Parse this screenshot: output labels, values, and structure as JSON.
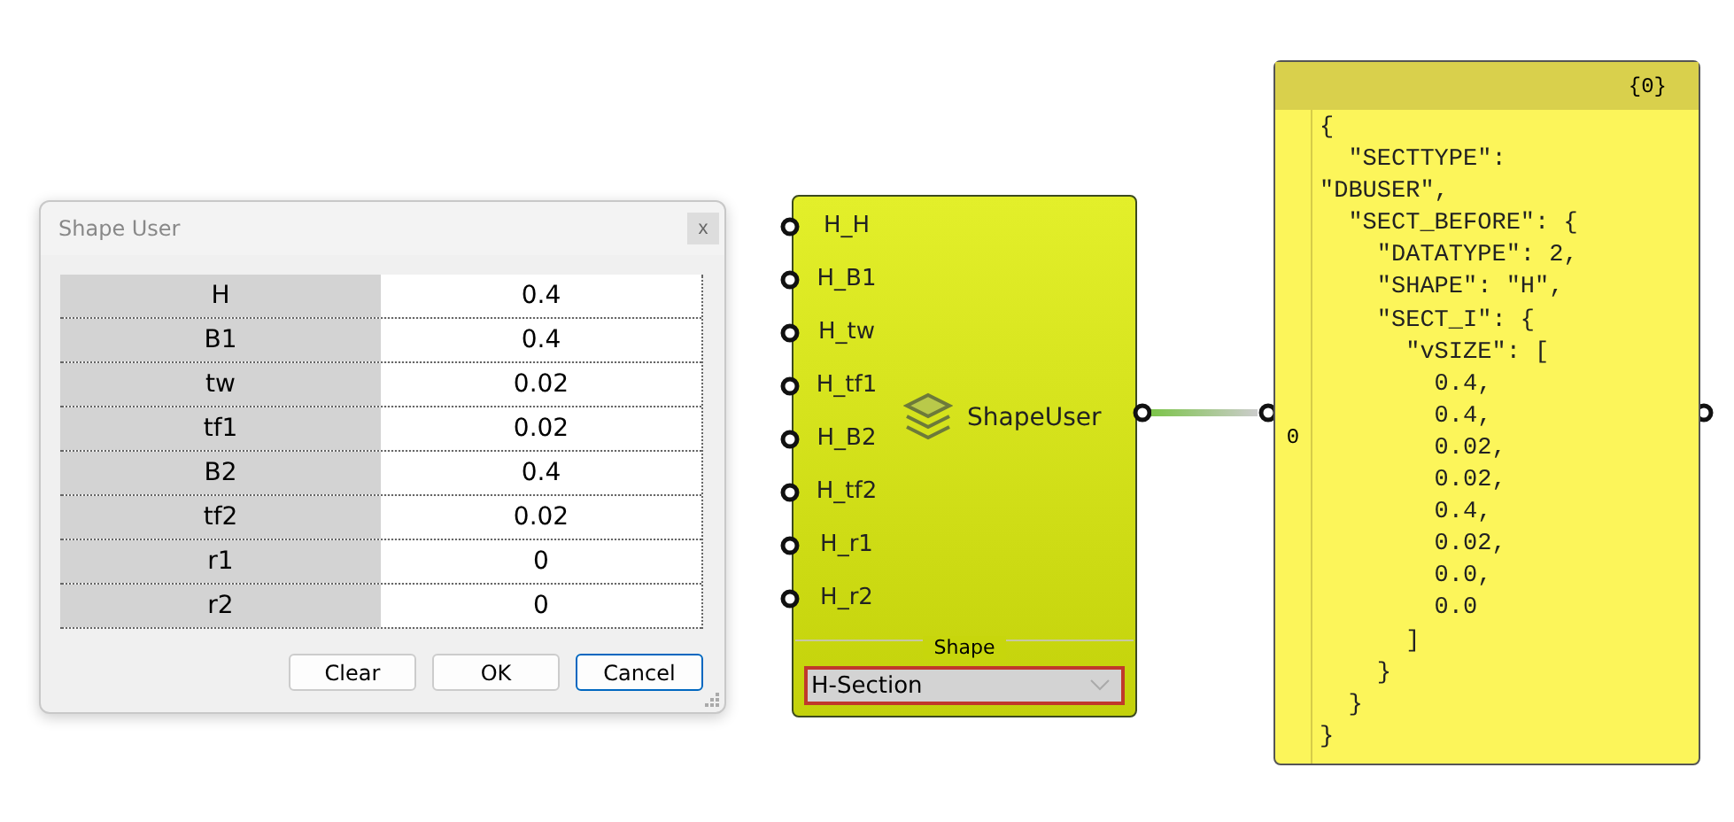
{
  "dialog": {
    "title": "Shape User",
    "close": "x",
    "rows": [
      {
        "label": "H",
        "value": "0.4"
      },
      {
        "label": "B1",
        "value": "0.4"
      },
      {
        "label": "tw",
        "value": "0.02"
      },
      {
        "label": "tf1",
        "value": "0.02"
      },
      {
        "label": "B2",
        "value": "0.4"
      },
      {
        "label": "tf2",
        "value": "0.02"
      },
      {
        "label": "r1",
        "value": "0"
      },
      {
        "label": "r2",
        "value": "0"
      }
    ],
    "buttons": [
      {
        "label": "Clear",
        "selected": false
      },
      {
        "label": "OK",
        "selected": false
      },
      {
        "label": "Cancel",
        "selected": true
      }
    ]
  },
  "component": {
    "name": "ShapeUser",
    "inputs": [
      "H_H",
      "H_B1",
      "H_tw",
      "H_tf1",
      "H_B2",
      "H_tf2",
      "H_r1",
      "H_r2"
    ],
    "section_label": "Shape",
    "dropdown": "H-Section"
  },
  "panel": {
    "header": "{0}",
    "index": "0",
    "lines": [
      "{",
      "  \"SECTTYPE\":",
      "\"DBUSER\",",
      "  \"SECT_BEFORE\": {",
      "    \"DATATYPE\": 2,",
      "    \"SHAPE\": \"H\",",
      "    \"SECT_I\": {",
      "      \"vSIZE\": [",
      "        0.4,",
      "        0.4,",
      "        0.02,",
      "        0.02,",
      "        0.4,",
      "        0.02,",
      "        0.0,",
      "        0.0",
      "      ]",
      "    }",
      "  }",
      "}"
    ]
  }
}
